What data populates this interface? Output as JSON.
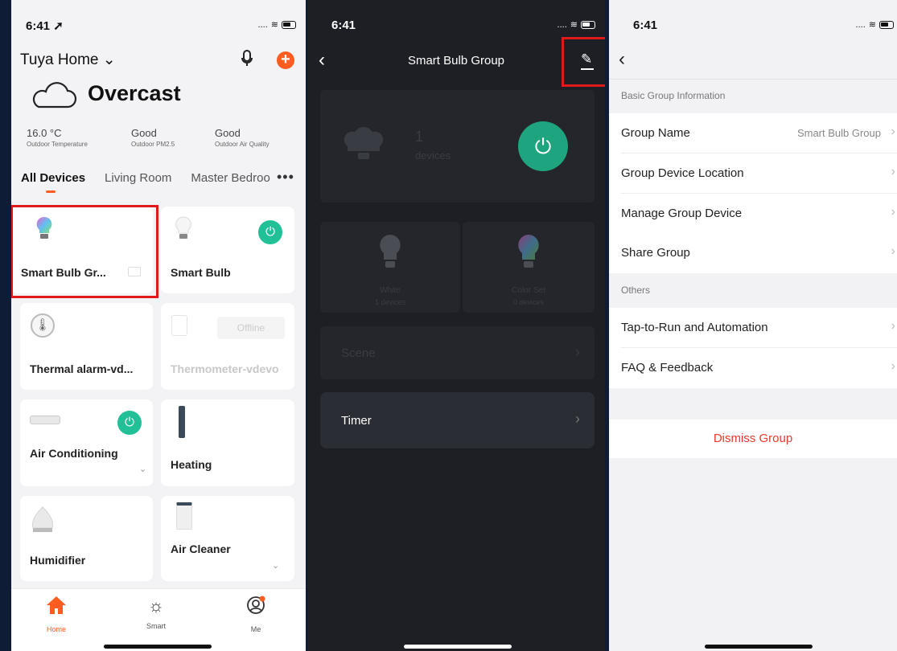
{
  "status": {
    "time1": "6:41 ➚",
    "time2": "6:41",
    "time3": "6:41",
    "signal": "....",
    "wifi": "≋"
  },
  "home": {
    "title": "Tuya Home ⌄",
    "weather": "Overcast",
    "env": [
      {
        "value": "16.0 °C",
        "label": "Outdoor Temperature"
      },
      {
        "value": "Good",
        "label": "Outdoor PM2.5"
      },
      {
        "value": "Good",
        "label": "Outdoor Air Quality"
      }
    ],
    "tabs": [
      "All Devices",
      "Living Room",
      "Master Bedroo"
    ],
    "more": "•••",
    "devices": {
      "smart_bulb_group": "Smart Bulb Gr...",
      "smart_bulb": "Smart Bulb",
      "thermal_alarm": "Thermal alarm-vd...",
      "thermometer": "Thermometer-vdevo",
      "thermometer_status": "Offline",
      "air_conditioning": "Air Conditioning",
      "heating": "Heating",
      "humidifier": "Humidifier",
      "air_cleaner": "Air Cleaner"
    },
    "tabbar": [
      {
        "label": "Home",
        "icon": "home-icon"
      },
      {
        "label": "Smart",
        "icon": "sun-icon"
      },
      {
        "label": "Me",
        "icon": "user-icon"
      }
    ]
  },
  "group_panel": {
    "title": "Smart Bulb Group",
    "count": "1",
    "count_label": "devices",
    "white": "White",
    "white_sub": "1 devices",
    "color_set": "Color Set",
    "color_sub": "0 devices",
    "scene": "Scene",
    "timer": "Timer"
  },
  "settings": {
    "section1": "Basic Group Information",
    "group_name_label": "Group Name",
    "group_name_value": "Smart Bulb Group",
    "location": "Group Device Location",
    "manage": "Manage Group Device",
    "share": "Share Group",
    "section2": "Others",
    "tap_to_run": "Tap-to-Run and Automation",
    "faq": "FAQ & Feedback",
    "dismiss": "Dismiss Group"
  },
  "colors": {
    "accent": "#ff5c1f",
    "power": "#22c096",
    "highlight": "#e0191a",
    "danger": "#ec3a2c"
  }
}
